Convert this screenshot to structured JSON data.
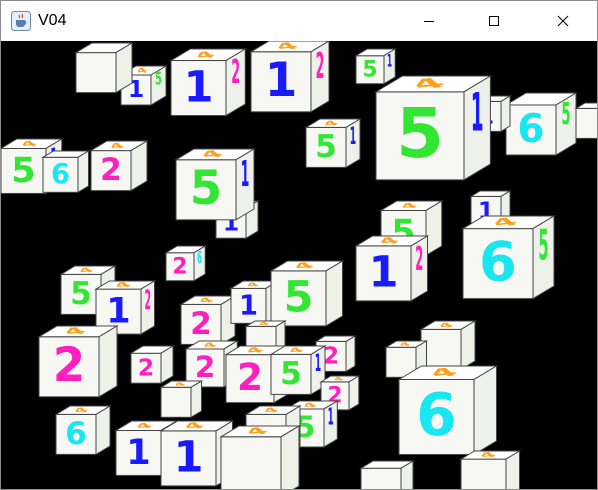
{
  "window": {
    "title": "V04",
    "icon": "java-coffee-cup-icon",
    "controls": [
      "minimize-icon",
      "maximize-icon",
      "close-icon"
    ]
  },
  "scene": {
    "background": "#000000",
    "cube_face_color": "#f7f8f4",
    "digit_colors": {
      "1": "#1a1aff",
      "2": "#ff1fbf",
      "4": "#ff9f1a",
      "5": "#33e633",
      "6": "#19e6f0"
    }
  }
}
